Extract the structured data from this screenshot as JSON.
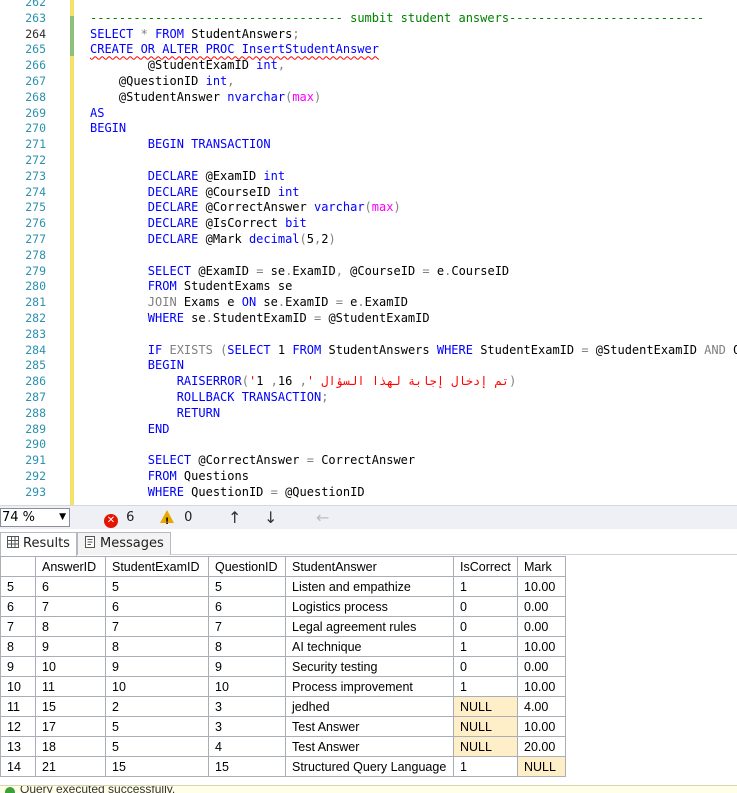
{
  "editor": {
    "lines": [
      {
        "n": "262",
        "code": []
      },
      {
        "n": "263",
        "code": [
          {
            "t": "-----------------------------------",
            "c": "c"
          },
          {
            "t": " sumbit student answers",
            "c": "c"
          },
          {
            "t": "---------------------------",
            "c": "c"
          }
        ]
      },
      {
        "n": "264",
        "cur": true,
        "code": [
          {
            "t": "SELECT",
            "c": "k"
          },
          {
            "t": " ",
            "c": ""
          },
          {
            "t": "*",
            "c": "g"
          },
          {
            "t": " ",
            "c": ""
          },
          {
            "t": "FROM",
            "c": "k"
          },
          {
            "t": " StudentAnswers",
            "c": ""
          },
          {
            "t": ";",
            "c": "g"
          }
        ]
      },
      {
        "n": "265",
        "code": [
          {
            "t": "CREATE OR ALTER PROC InsertStudentAnswer",
            "c": "squigmix"
          }
        ]
      },
      {
        "n": "266",
        "code": [
          {
            "t": "        @StudentExamID ",
            "c": ""
          },
          {
            "t": "int",
            "c": "k"
          },
          {
            "t": ",",
            "c": "g"
          }
        ]
      },
      {
        "n": "267",
        "code": [
          {
            "t": "    @QuestionID ",
            "c": ""
          },
          {
            "t": "int",
            "c": "k"
          },
          {
            "t": ",",
            "c": "g"
          }
        ]
      },
      {
        "n": "268",
        "code": [
          {
            "t": "    @StudentAnswer ",
            "c": ""
          },
          {
            "t": "nvarchar",
            "c": "k"
          },
          {
            "t": "(",
            "c": "g"
          },
          {
            "t": "max",
            "c": "p"
          },
          {
            "t": ")",
            "c": "g"
          }
        ]
      },
      {
        "n": "269",
        "code": [
          {
            "t": "AS",
            "c": "k"
          }
        ]
      },
      {
        "n": "270",
        "code": [
          {
            "t": "BEGIN",
            "c": "k"
          }
        ]
      },
      {
        "n": "271",
        "code": [
          {
            "t": "        BEGIN TRANSACTION",
            "c": "k"
          }
        ]
      },
      {
        "n": "272",
        "code": []
      },
      {
        "n": "273",
        "code": [
          {
            "t": "        DECLARE",
            "c": "k"
          },
          {
            "t": " @ExamID ",
            "c": ""
          },
          {
            "t": "int",
            "c": "k"
          }
        ]
      },
      {
        "n": "274",
        "code": [
          {
            "t": "        DECLARE",
            "c": "k"
          },
          {
            "t": " @CourseID ",
            "c": ""
          },
          {
            "t": "int",
            "c": "k"
          }
        ]
      },
      {
        "n": "275",
        "code": [
          {
            "t": "        DECLARE",
            "c": "k"
          },
          {
            "t": " @CorrectAnswer ",
            "c": ""
          },
          {
            "t": "varchar",
            "c": "k"
          },
          {
            "t": "(",
            "c": "g"
          },
          {
            "t": "max",
            "c": "p"
          },
          {
            "t": ")",
            "c": "g"
          }
        ]
      },
      {
        "n": "276",
        "code": [
          {
            "t": "        DECLARE",
            "c": "k"
          },
          {
            "t": " @IsCorrect ",
            "c": ""
          },
          {
            "t": "bit",
            "c": "k"
          }
        ]
      },
      {
        "n": "277",
        "code": [
          {
            "t": "        DECLARE",
            "c": "k"
          },
          {
            "t": " @Mark ",
            "c": ""
          },
          {
            "t": "decimal",
            "c": "k"
          },
          {
            "t": "(",
            "c": "g"
          },
          {
            "t": "5",
            "c": ""
          },
          {
            "t": ",",
            "c": "g"
          },
          {
            "t": "2",
            "c": ""
          },
          {
            "t": ")",
            "c": "g"
          }
        ]
      },
      {
        "n": "278",
        "code": []
      },
      {
        "n": "279",
        "code": [
          {
            "t": "        SELECT",
            "c": "k"
          },
          {
            "t": " @ExamID ",
            "c": ""
          },
          {
            "t": "=",
            "c": "g"
          },
          {
            "t": " se",
            "c": ""
          },
          {
            "t": ".",
            "c": "g"
          },
          {
            "t": "ExamID",
            "c": ""
          },
          {
            "t": ",",
            "c": "g"
          },
          {
            "t": " @CourseID ",
            "c": ""
          },
          {
            "t": "=",
            "c": "g"
          },
          {
            "t": " e",
            "c": ""
          },
          {
            "t": ".",
            "c": "g"
          },
          {
            "t": "CourseID",
            "c": ""
          }
        ]
      },
      {
        "n": "280",
        "code": [
          {
            "t": "        FROM",
            "c": "k"
          },
          {
            "t": " StudentExams se",
            "c": ""
          }
        ]
      },
      {
        "n": "281",
        "code": [
          {
            "t": "        JOIN",
            "c": "g"
          },
          {
            "t": " Exams e ",
            "c": ""
          },
          {
            "t": "ON",
            "c": "k"
          },
          {
            "t": " se",
            "c": ""
          },
          {
            "t": ".",
            "c": "g"
          },
          {
            "t": "ExamID ",
            "c": ""
          },
          {
            "t": "=",
            "c": "g"
          },
          {
            "t": " e",
            "c": ""
          },
          {
            "t": ".",
            "c": "g"
          },
          {
            "t": "ExamID",
            "c": ""
          }
        ]
      },
      {
        "n": "282",
        "code": [
          {
            "t": "        WHERE",
            "c": "k"
          },
          {
            "t": " se",
            "c": ""
          },
          {
            "t": ".",
            "c": "g"
          },
          {
            "t": "StudentExamID ",
            "c": ""
          },
          {
            "t": "=",
            "c": "g"
          },
          {
            "t": " @StudentExamID",
            "c": ""
          }
        ]
      },
      {
        "n": "283",
        "code": []
      },
      {
        "n": "284",
        "code": [
          {
            "t": "        IF",
            "c": "k"
          },
          {
            "t": " ",
            "c": ""
          },
          {
            "t": "EXISTS",
            "c": "g"
          },
          {
            "t": " (",
            "c": "g"
          },
          {
            "t": "SELECT",
            "c": "k"
          },
          {
            "t": " 1 ",
            "c": ""
          },
          {
            "t": "FROM",
            "c": "k"
          },
          {
            "t": " StudentAnswers ",
            "c": ""
          },
          {
            "t": "WHERE",
            "c": "k"
          },
          {
            "t": " StudentExamID ",
            "c": ""
          },
          {
            "t": "=",
            "c": "g"
          },
          {
            "t": " @StudentExamID ",
            "c": ""
          },
          {
            "t": "AND",
            "c": "g"
          },
          {
            "t": " Qu",
            "c": ""
          }
        ]
      },
      {
        "n": "285",
        "code": [
          {
            "t": "        BEGIN",
            "c": "k"
          }
        ]
      },
      {
        "n": "286",
        "code": [
          {
            "t": "            RAISERROR",
            "c": "k"
          },
          {
            "t": "(",
            "c": "g"
          },
          {
            "t": "'تم إدخال إجابة لهذا السؤال '",
            "c": "s"
          },
          {
            "t": ",",
            "c": "g"
          },
          {
            "t": " 16",
            "c": ""
          },
          {
            "t": ",",
            "c": "g"
          },
          {
            "t": " 1",
            "c": ""
          },
          {
            "t": ")",
            "c": "g"
          }
        ]
      },
      {
        "n": "287",
        "code": [
          {
            "t": "            ROLLBACK TRANSACTION",
            "c": "k"
          },
          {
            "t": ";",
            "c": "g"
          }
        ]
      },
      {
        "n": "288",
        "code": [
          {
            "t": "            RETURN",
            "c": "k"
          }
        ]
      },
      {
        "n": "289",
        "code": [
          {
            "t": "        END",
            "c": "k"
          }
        ]
      },
      {
        "n": "290",
        "code": []
      },
      {
        "n": "291",
        "code": [
          {
            "t": "        SELECT",
            "c": "k"
          },
          {
            "t": " @CorrectAnswer ",
            "c": ""
          },
          {
            "t": "=",
            "c": "g"
          },
          {
            "t": " CorrectAnswer",
            "c": ""
          }
        ]
      },
      {
        "n": "292",
        "code": [
          {
            "t": "        FROM",
            "c": "k"
          },
          {
            "t": " Questions",
            "c": ""
          }
        ]
      },
      {
        "n": "293",
        "code": [
          {
            "t": "        WHERE",
            "c": "k"
          },
          {
            "t": " QuestionID ",
            "c": ""
          },
          {
            "t": "=",
            "c": "g"
          },
          {
            "t": " @QuestionID",
            "c": ""
          }
        ]
      }
    ]
  },
  "toolbar": {
    "zoom": "74 %",
    "errors": "6",
    "warnings": "0"
  },
  "tabs": {
    "results": "Results",
    "messages": "Messages"
  },
  "grid": {
    "columns": [
      "AnswerID",
      "StudentExamID",
      "QuestionID",
      "StudentAnswer",
      "IsCorrect",
      "Mark"
    ],
    "rows": [
      {
        "rn": "5",
        "cells": [
          "6",
          "5",
          "5",
          "Listen and empathize",
          "1",
          "10.00"
        ]
      },
      {
        "rn": "6",
        "cells": [
          "7",
          "6",
          "6",
          "Logistics process",
          "0",
          "0.00"
        ]
      },
      {
        "rn": "7",
        "cells": [
          "8",
          "7",
          "7",
          "Legal agreement rules",
          "0",
          "0.00"
        ]
      },
      {
        "rn": "8",
        "cells": [
          "9",
          "8",
          "8",
          "AI technique",
          "1",
          "10.00"
        ]
      },
      {
        "rn": "9",
        "cells": [
          "10",
          "9",
          "9",
          "Security testing",
          "0",
          "0.00"
        ]
      },
      {
        "rn": "10",
        "cells": [
          "11",
          "10",
          "10",
          "Process improvement",
          "1",
          "10.00"
        ]
      },
      {
        "rn": "11",
        "cells": [
          "15",
          "2",
          "3",
          "jedhed",
          "NULL",
          "4.00"
        ]
      },
      {
        "rn": "12",
        "cells": [
          "17",
          "5",
          "3",
          "Test Answer",
          "NULL",
          "10.00"
        ]
      },
      {
        "rn": "13",
        "cells": [
          "18",
          "5",
          "4",
          "Test Answer",
          "NULL",
          "20.00"
        ]
      },
      {
        "rn": "14",
        "cells": [
          "21",
          "15",
          "15",
          "Structured Query Language",
          "1",
          "NULL"
        ]
      }
    ]
  },
  "status": {
    "message": "Query executed successfully."
  }
}
